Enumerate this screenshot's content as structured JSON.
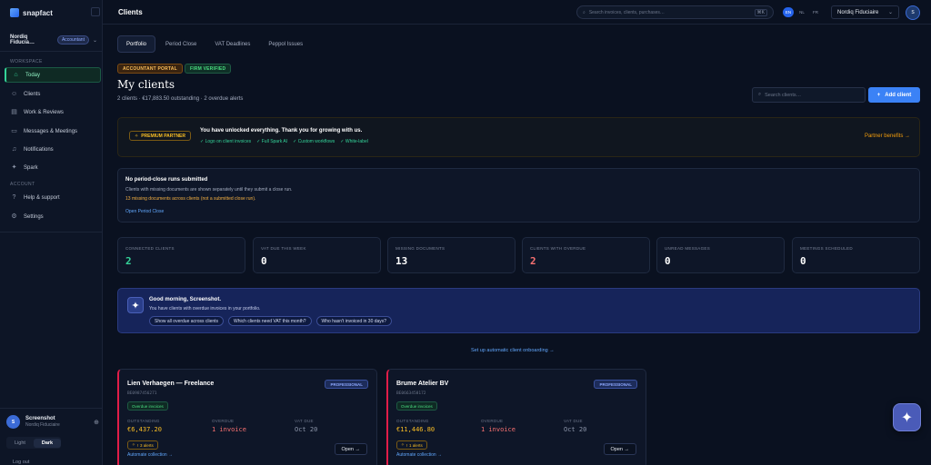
{
  "brand": {
    "name": "snapfact",
    "icon": "logo-icon"
  },
  "sidebar": {
    "org_name": "Nordiq Fiducia…",
    "org_role": "Accountant",
    "sections": {
      "workspace": "WORKSPACE",
      "account": "ACCOUNT"
    },
    "items": [
      {
        "label": "Today",
        "icon": "home-icon",
        "active": true
      },
      {
        "label": "Clients",
        "icon": "users-icon"
      },
      {
        "label": "Work & Reviews",
        "icon": "clipboard-icon"
      },
      {
        "label": "Messages & Meetings",
        "icon": "chat-icon"
      },
      {
        "label": "Notifications",
        "icon": "bell-icon"
      },
      {
        "label": "Spark",
        "icon": "sparkle-icon"
      }
    ],
    "account_items": [
      {
        "label": "Help & support",
        "icon": "help-icon"
      },
      {
        "label": "Settings",
        "icon": "gear-icon"
      }
    ],
    "user": {
      "initial": "S",
      "name": "Screenshot",
      "org": "Nordiq Fiduciaire"
    },
    "theme": {
      "light": "Light",
      "dark": "Dark",
      "selected": "Dark"
    },
    "logout": "Log out"
  },
  "header": {
    "title": "Clients",
    "search_placeholder": "Search invoices, clients, purchases…",
    "search_shortcut": "⌘K",
    "languages": [
      "EN",
      "NL",
      "FR"
    ],
    "active_language": "EN",
    "org_select": "Nordiq Fiduciaire",
    "avatar_initial": "S"
  },
  "tabs": [
    "Portfolio",
    "Period Close",
    "VAT Deadlines",
    "Peppol Issues"
  ],
  "active_tab": "Portfolio",
  "pills": {
    "portal": "ACCOUNTANT PORTAL",
    "firm": "FIRM VERIFIED"
  },
  "main": {
    "title": "My clients",
    "subtitle": "2 clients · €17,883.50 outstanding · 2 overdue alerts",
    "search_placeholder": "Search clients…",
    "add_button": "Add client"
  },
  "partner": {
    "badge": "PREMIUM PARTNER",
    "title": "You have unlocked everything. Thank you for growing with us.",
    "features": [
      "✓ Logo on client invoices",
      "✓ Full Spark AI",
      "✓ Custom workflows",
      "✓ White-label"
    ],
    "link": "Partner benefits →"
  },
  "notice": {
    "title": "No period-close runs submitted",
    "body": "Clients with missing documents are shown separately until they submit a close run.",
    "warning": "13 missing documents across clients (not a submitted close run).",
    "link": "Open Period Close"
  },
  "stats": [
    {
      "label": "CONNECTED CLIENTS",
      "value": "2",
      "color": "#34d399"
    },
    {
      "label": "VAT DUE THIS WEEK",
      "value": "0",
      "color": "#ffffff"
    },
    {
      "label": "MISSING DOCUMENTS",
      "value": "13",
      "color": "#ffffff"
    },
    {
      "label": "CLIENTS WITH OVERDUE",
      "value": "2",
      "color": "#f87171"
    },
    {
      "label": "UNREAD MESSAGES",
      "value": "0",
      "color": "#ffffff"
    },
    {
      "label": "MEETINGS SCHEDULED",
      "value": "0",
      "color": "#ffffff"
    }
  ],
  "assistant": {
    "title": "Good morning, Screenshot.",
    "subtitle": "You have clients with overdue invoices in your portfolio.",
    "chips": [
      "Show all overdue across clients",
      "Which clients need VAT this month?",
      "Who hasn't invoiced in 30 days?"
    ]
  },
  "onboarding_link": "Set up automatic client onboarding →",
  "clients": [
    {
      "name": "Lien Verhaegen — Freelance",
      "id": "BE0987456271",
      "tier": "PROFESSIONAL",
      "flag": "Overdue invoices",
      "outstanding_label": "OUTSTANDING",
      "outstanding": "€6,437.20",
      "overdue_label": "OVERDUE",
      "overdue": "1 invoice",
      "vat_label": "VAT DUE",
      "vat": "Oct 20",
      "alerts": "3 alerts",
      "collection": "Automate collection →",
      "open": "Open →"
    },
    {
      "name": "Brume Atelier BV",
      "id": "BE0663458172",
      "tier": "PROFESSIONAL",
      "flag": "Overdue invoices",
      "outstanding_label": "OUTSTANDING",
      "outstanding": "€11,446.80",
      "overdue_label": "OVERDUE",
      "overdue": "1 invoice",
      "vat_label": "VAT DUE",
      "vat": "Oct 20",
      "alerts": "1 alerts",
      "collection": "Automate collection →",
      "open": "Open →"
    }
  ],
  "colors": {
    "accent": "#3b82f6",
    "success": "#34d399",
    "danger": "#f87171",
    "warning": "#fbbf24"
  }
}
